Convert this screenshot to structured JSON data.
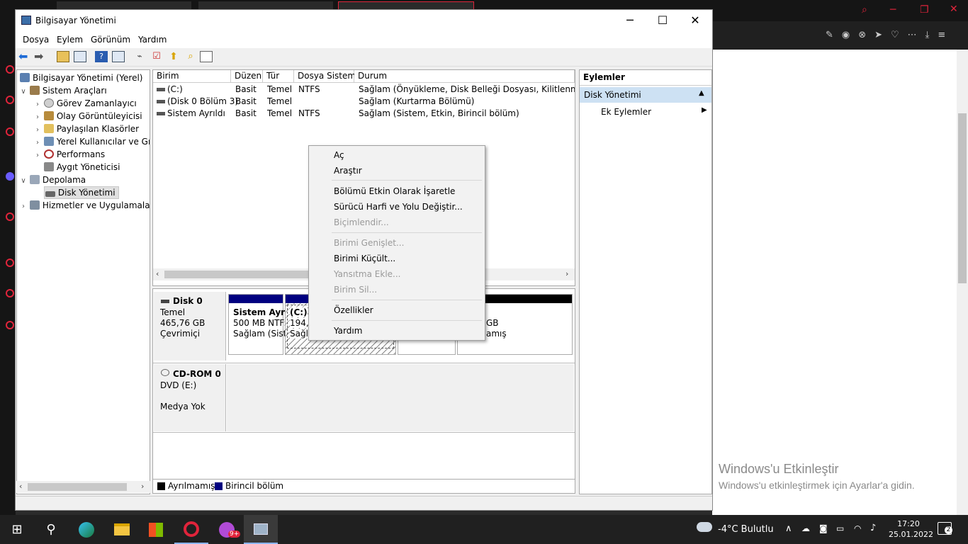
{
  "window": {
    "title": "Bilgisayar Yönetimi",
    "minimize": "─",
    "maximize": "☐",
    "close": "✕"
  },
  "menu": [
    "Dosya",
    "Eylem",
    "Görünüm",
    "Yardım"
  ],
  "tree": {
    "root": "Bilgisayar Yönetimi (Yerel)",
    "system_tools": "Sistem Araçları",
    "task_scheduler": "Görev Zamanlayıcı",
    "event_viewer": "Olay Görüntüleyicisi",
    "shared_folders": "Paylaşılan Klasörler",
    "local_users": "Yerel Kullanıcılar ve Gru",
    "performance": "Performans",
    "device_manager": "Aygıt Yöneticisi",
    "storage": "Depolama",
    "disk_management": "Disk Yönetimi",
    "services": "Hizmetler ve Uygulamalar"
  },
  "volume_list": {
    "columns": [
      "Birim",
      "Düzen",
      "Tür",
      "Dosya Sistemi",
      "Durum"
    ],
    "rows": [
      {
        "name": "(C:)",
        "layout": "Basit",
        "type": "Temel",
        "fs": "NTFS",
        "status": "Sağlam (Önyükleme, Disk Belleği Dosyası, Kilitlenme Bilgis"
      },
      {
        "name": "(Disk 0 Bölüm 3)",
        "layout": "Basit",
        "type": "Temel",
        "fs": "",
        "status": "Sağlam (Kurtarma Bölümü)"
      },
      {
        "name": "Sistem Ayrıldı",
        "layout": "Basit",
        "type": "Temel",
        "fs": "NTFS",
        "status": "Sağlam (Sistem, Etkin, Birincil bölüm)"
      }
    ]
  },
  "disk0": {
    "name": "Disk 0",
    "type": "Temel",
    "size": "465,76 GB",
    "state": "Çevrimiçi",
    "p1_name": "Sistem Ayrıl",
    "p1_size": "500 MB NTF:",
    "p1_status": "Sağlam (Sist",
    "p2_name": "(C:)",
    "p2_size": "194,2",
    "p2_status": "Sağla",
    "p4_size": "GB",
    "p4_status": "amış"
  },
  "cdrom": {
    "name": "CD-ROM 0",
    "drive": "DVD (E:)",
    "media": "Medya Yok"
  },
  "legend": {
    "unallocated": "Ayrılmamış",
    "primary": "Birincil bölüm",
    "unallocated_color": "#000000",
    "primary_color": "#000080"
  },
  "actions": {
    "header": "Eylemler",
    "section": "Disk Yönetimi",
    "more": "Ek Eylemler"
  },
  "context_menu": {
    "open": "Aç",
    "explore": "Araştır",
    "mark_active": "Bölümü Etkin Olarak İşaretle",
    "change_letter": "Sürücü Harfi ve Yolu Değiştir...",
    "format": "Biçimlendir...",
    "extend": "Birimi Genişlet...",
    "shrink": "Birimi Küçült...",
    "add_mirror": "Yansıtma Ekle...",
    "delete": "Birim Sil...",
    "properties": "Özellikler",
    "help": "Yardım"
  },
  "watermark": {
    "title": "Windows'u Etkinleştir",
    "subtitle": "Windows'u etkinleştirmek için Ayarlar'a gidin."
  },
  "taskbar": {
    "weather": "-4°C  Bulutlu",
    "time": "17:20",
    "date": "25.01.2022",
    "notifications": "2",
    "badge": "9+"
  },
  "colors": {
    "accent": "#cde8ff",
    "opera": "#e0243b",
    "selection": "#cce8ff"
  }
}
